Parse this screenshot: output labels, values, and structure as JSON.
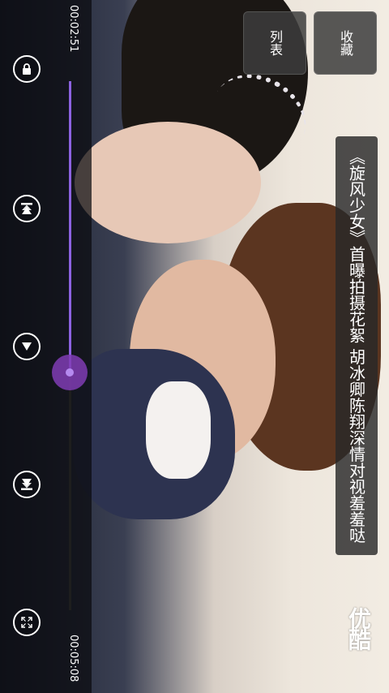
{
  "player": {
    "time_elapsed": "00:02:51",
    "time_total": "00:05:08",
    "progress": 0.55
  },
  "buttons": {
    "list_label": "列表",
    "favorite_label": "收藏"
  },
  "video": {
    "title": "《旋风少女》首曝拍摄花絮 胡冰卿陈翔深情对视羞羞哒",
    "watermark": "优酷"
  },
  "icons": {
    "lock": "lock-icon",
    "previous": "skip-previous-icon",
    "play": "play-icon",
    "next": "skip-next-icon",
    "fullscreen": "fullscreen-icon"
  },
  "colors": {
    "accent": "#8c62e0",
    "thumb": "#803cb4"
  }
}
